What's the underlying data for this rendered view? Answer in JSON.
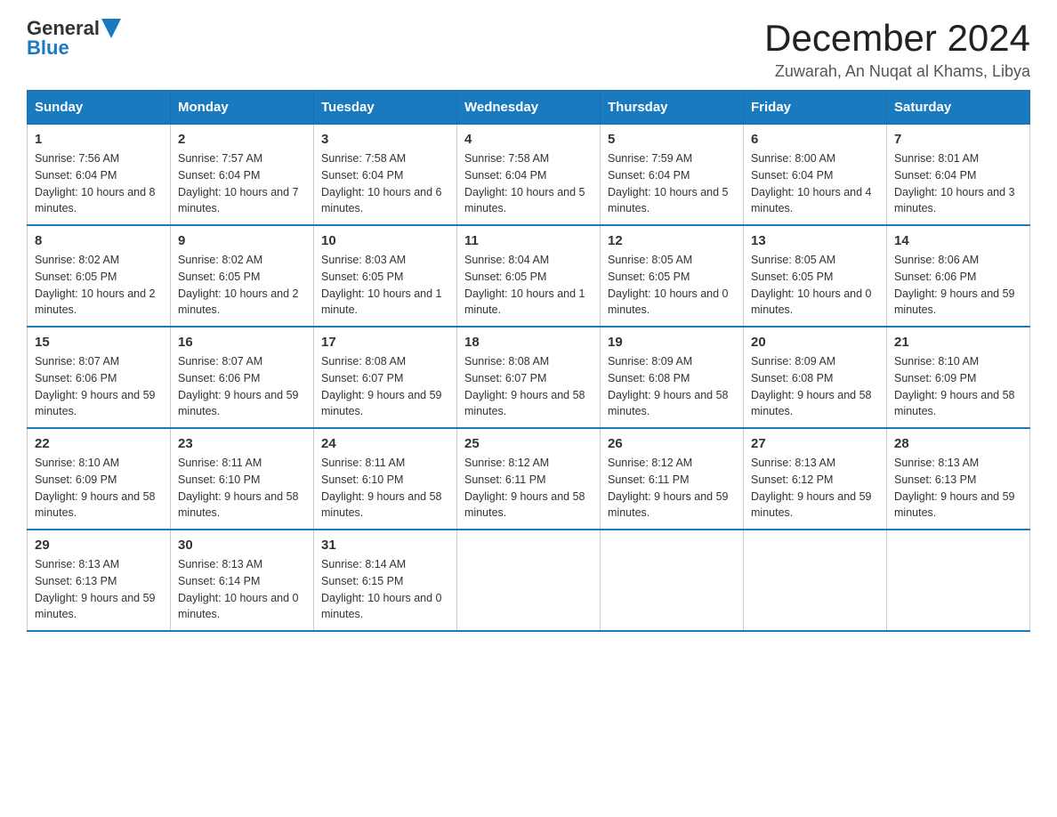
{
  "header": {
    "logo_general": "General",
    "logo_blue": "Blue",
    "month_title": "December 2024",
    "location": "Zuwarah, An Nuqat al Khams, Libya"
  },
  "weekdays": [
    "Sunday",
    "Monday",
    "Tuesday",
    "Wednesday",
    "Thursday",
    "Friday",
    "Saturday"
  ],
  "weeks": [
    [
      {
        "day": "1",
        "sunrise": "7:56 AM",
        "sunset": "6:04 PM",
        "daylight": "10 hours and 8 minutes."
      },
      {
        "day": "2",
        "sunrise": "7:57 AM",
        "sunset": "6:04 PM",
        "daylight": "10 hours and 7 minutes."
      },
      {
        "day": "3",
        "sunrise": "7:58 AM",
        "sunset": "6:04 PM",
        "daylight": "10 hours and 6 minutes."
      },
      {
        "day": "4",
        "sunrise": "7:58 AM",
        "sunset": "6:04 PM",
        "daylight": "10 hours and 5 minutes."
      },
      {
        "day": "5",
        "sunrise": "7:59 AM",
        "sunset": "6:04 PM",
        "daylight": "10 hours and 5 minutes."
      },
      {
        "day": "6",
        "sunrise": "8:00 AM",
        "sunset": "6:04 PM",
        "daylight": "10 hours and 4 minutes."
      },
      {
        "day": "7",
        "sunrise": "8:01 AM",
        "sunset": "6:04 PM",
        "daylight": "10 hours and 3 minutes."
      }
    ],
    [
      {
        "day": "8",
        "sunrise": "8:02 AM",
        "sunset": "6:05 PM",
        "daylight": "10 hours and 2 minutes."
      },
      {
        "day": "9",
        "sunrise": "8:02 AM",
        "sunset": "6:05 PM",
        "daylight": "10 hours and 2 minutes."
      },
      {
        "day": "10",
        "sunrise": "8:03 AM",
        "sunset": "6:05 PM",
        "daylight": "10 hours and 1 minute."
      },
      {
        "day": "11",
        "sunrise": "8:04 AM",
        "sunset": "6:05 PM",
        "daylight": "10 hours and 1 minute."
      },
      {
        "day": "12",
        "sunrise": "8:05 AM",
        "sunset": "6:05 PM",
        "daylight": "10 hours and 0 minutes."
      },
      {
        "day": "13",
        "sunrise": "8:05 AM",
        "sunset": "6:05 PM",
        "daylight": "10 hours and 0 minutes."
      },
      {
        "day": "14",
        "sunrise": "8:06 AM",
        "sunset": "6:06 PM",
        "daylight": "9 hours and 59 minutes."
      }
    ],
    [
      {
        "day": "15",
        "sunrise": "8:07 AM",
        "sunset": "6:06 PM",
        "daylight": "9 hours and 59 minutes."
      },
      {
        "day": "16",
        "sunrise": "8:07 AM",
        "sunset": "6:06 PM",
        "daylight": "9 hours and 59 minutes."
      },
      {
        "day": "17",
        "sunrise": "8:08 AM",
        "sunset": "6:07 PM",
        "daylight": "9 hours and 59 minutes."
      },
      {
        "day": "18",
        "sunrise": "8:08 AM",
        "sunset": "6:07 PM",
        "daylight": "9 hours and 58 minutes."
      },
      {
        "day": "19",
        "sunrise": "8:09 AM",
        "sunset": "6:08 PM",
        "daylight": "9 hours and 58 minutes."
      },
      {
        "day": "20",
        "sunrise": "8:09 AM",
        "sunset": "6:08 PM",
        "daylight": "9 hours and 58 minutes."
      },
      {
        "day": "21",
        "sunrise": "8:10 AM",
        "sunset": "6:09 PM",
        "daylight": "9 hours and 58 minutes."
      }
    ],
    [
      {
        "day": "22",
        "sunrise": "8:10 AM",
        "sunset": "6:09 PM",
        "daylight": "9 hours and 58 minutes."
      },
      {
        "day": "23",
        "sunrise": "8:11 AM",
        "sunset": "6:10 PM",
        "daylight": "9 hours and 58 minutes."
      },
      {
        "day": "24",
        "sunrise": "8:11 AM",
        "sunset": "6:10 PM",
        "daylight": "9 hours and 58 minutes."
      },
      {
        "day": "25",
        "sunrise": "8:12 AM",
        "sunset": "6:11 PM",
        "daylight": "9 hours and 58 minutes."
      },
      {
        "day": "26",
        "sunrise": "8:12 AM",
        "sunset": "6:11 PM",
        "daylight": "9 hours and 59 minutes."
      },
      {
        "day": "27",
        "sunrise": "8:13 AM",
        "sunset": "6:12 PM",
        "daylight": "9 hours and 59 minutes."
      },
      {
        "day": "28",
        "sunrise": "8:13 AM",
        "sunset": "6:13 PM",
        "daylight": "9 hours and 59 minutes."
      }
    ],
    [
      {
        "day": "29",
        "sunrise": "8:13 AM",
        "sunset": "6:13 PM",
        "daylight": "9 hours and 59 minutes."
      },
      {
        "day": "30",
        "sunrise": "8:13 AM",
        "sunset": "6:14 PM",
        "daylight": "10 hours and 0 minutes."
      },
      {
        "day": "31",
        "sunrise": "8:14 AM",
        "sunset": "6:15 PM",
        "daylight": "10 hours and 0 minutes."
      },
      null,
      null,
      null,
      null
    ]
  ]
}
